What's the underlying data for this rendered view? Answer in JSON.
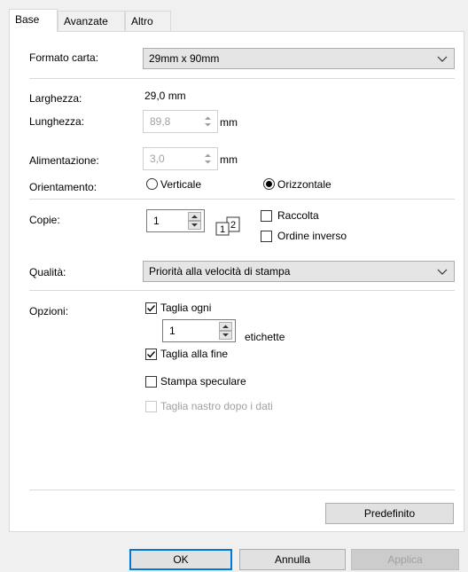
{
  "tabs": [
    {
      "label": "Base"
    },
    {
      "label": "Avanzate"
    },
    {
      "label": "Altro"
    }
  ],
  "form": {
    "paper_size": {
      "label": "Formato carta:",
      "value": "29mm x 90mm"
    },
    "width": {
      "label": "Larghezza:",
      "value": "29,0 mm"
    },
    "length": {
      "label": "Lunghezza:",
      "value": "89,8",
      "unit": "mm"
    },
    "feed": {
      "label": "Alimentazione:",
      "value": "3,0",
      "unit": "mm"
    },
    "orientation": {
      "label": "Orientamento:",
      "option_portrait": "Verticale",
      "option_landscape": "Orizzontale",
      "selected": "Orizzontale"
    },
    "copies": {
      "label": "Copie:",
      "value": "1",
      "collate_label": "Raccolta",
      "reverse_label": "Ordine inverso",
      "collate_checked": false,
      "reverse_checked": false
    },
    "quality": {
      "label": "Qualità:",
      "value": "Priorità alla velocità di stampa"
    },
    "options": {
      "label": "Opzioni:",
      "cut_every": {
        "label": "Taglia ogni",
        "checked": true
      },
      "cut_every_value": "1",
      "cut_every_unit": "etichette",
      "cut_at_end": {
        "label": "Taglia alla fine",
        "checked": true
      },
      "mirror_print": {
        "label": "Stampa speculare",
        "checked": false
      },
      "cut_tape_after_data": {
        "label": "Taglia nastro dopo i dati",
        "checked": false,
        "enabled": false
      }
    },
    "default_button": "Predefinito"
  },
  "footer": {
    "ok": "OK",
    "cancel": "Annulla",
    "apply": "Applica"
  },
  "icons": {
    "collate": "collate-pages-icon",
    "dropdown": "chevron-down-icon",
    "spin": "spin-arrows-icon",
    "check": "checkmark-icon"
  },
  "colors": {
    "accent": "#0078d7",
    "disabled_text": "#a0a0a0",
    "panel_bg": "#ffffff",
    "window_bg": "#f0f0f0"
  }
}
